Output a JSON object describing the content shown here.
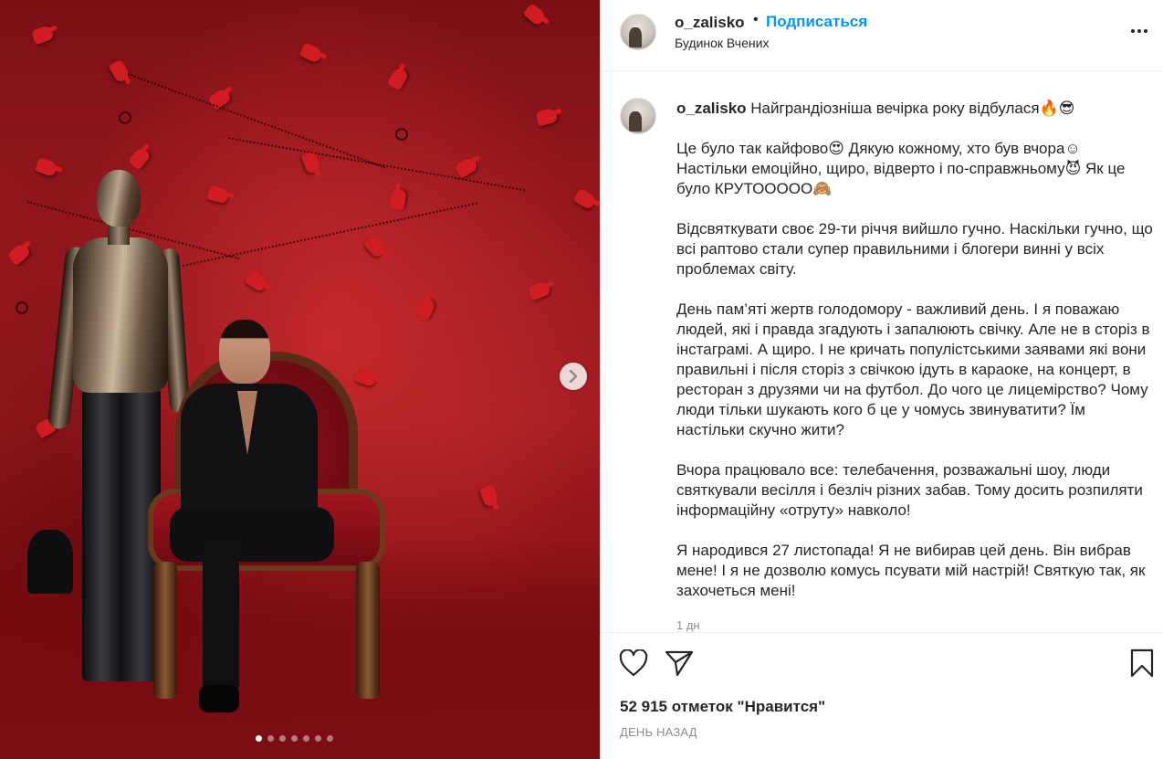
{
  "post": {
    "username": "o_zalisko",
    "separator": "•",
    "follow_label": "Подписаться",
    "location": "Будинок Вчених",
    "more_icon": "more-horizontal-icon"
  },
  "photo": {
    "slide_count": 7,
    "active_slide": 1,
    "next_icon": "chevron-right-icon"
  },
  "caption": {
    "username": "o_zalisko",
    "text": " Найграндіозніша вечірка року відбулася🔥😎\n\nЦе було так кайфово😍 Дякую кожному, хто був вчора☺\nНастільки емоційно, щиро, відверто і по-справжньому😈 Як це було КРУТООООО🙈\n\nВідсвяткувати своє 29-ти річчя вийшло гучно. Наскільки гучно, що всі раптово стали супер правильними і блогери винні у всіх проблемах світу.\n\nДень пам’яті жертв голодомору - важливий день. І я поважаю людей, які і правда згадують і запалюють свічку. Але не в сторіз в інстаграмі. А щиро. І не кричать популістськими заявами які вони правильні і після сторіз з свічкою ідуть в караоке, на концерт, в ресторан з друзями чи на футбол. До чого це лицемірство? Чому люди тільки шукають кого б це у чомусь звинуватити? Їм настільки скучно жити?\n\nВчора працювало все: телебачення, розважальні шоу, люди святкували весілля і безліч різних забав. Тому досить розпиляти інформаційну «отруту» навколо!\n\nЯ народився 27 листопада! Я не вибирав цей день. Він вибрав мене! І я не дозволю комусь псувати мій настрій! Святкую так, як захочеться мені!",
    "time": "1 дн"
  },
  "actions": {
    "like_icon": "heart-icon",
    "share_icon": "paper-plane-icon",
    "save_icon": "bookmark-icon",
    "likes_text": "52 915 отметок \"Нравится\"",
    "posted_text": "день назад"
  },
  "colors": {
    "accent": "#0095f6",
    "text": "#262626",
    "muted": "#8e8e8e",
    "border": "#efefef"
  }
}
